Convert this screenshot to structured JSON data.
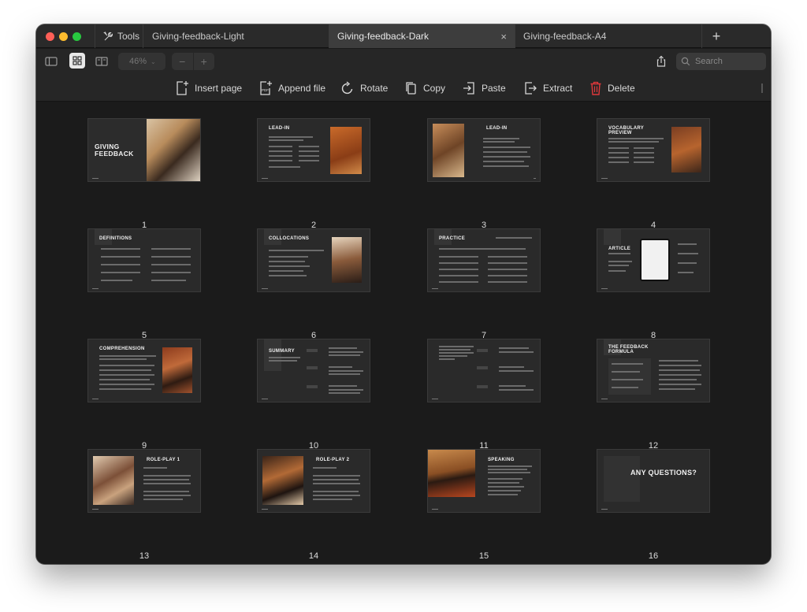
{
  "tabbar": {
    "tools_label": "Tools",
    "tabs": [
      {
        "label": "Giving-feedback-Light"
      },
      {
        "label": "Giving-feedback-Dark",
        "active": true
      },
      {
        "label": "Giving-feedback-A4"
      }
    ],
    "close_symbol": "×",
    "new_tab_symbol": "+"
  },
  "toolbar": {
    "zoom": "46%",
    "zoom_out": "−",
    "zoom_in": "+",
    "search_placeholder": "Search",
    "view_icons": [
      "sidebar-icon",
      "grid-view-icon",
      "page-view-icon"
    ]
  },
  "actions": [
    {
      "label": "Insert page",
      "icon": "insert-page-icon"
    },
    {
      "label": "Append file",
      "icon": "append-pdf-icon"
    },
    {
      "label": "Rotate",
      "icon": "rotate-icon"
    },
    {
      "label": "Copy",
      "icon": "copy-icon"
    },
    {
      "label": "Paste",
      "icon": "paste-icon"
    },
    {
      "label": "Extract",
      "icon": "extract-icon"
    },
    {
      "label": "Delete",
      "icon": "trash-icon",
      "color": "#e0383b"
    }
  ],
  "pages": [
    {
      "number": "1",
      "title": "GIVING FEEDBACK"
    },
    {
      "number": "2",
      "title": "LEAD-IN"
    },
    {
      "number": "3",
      "title": "LEAD-IN"
    },
    {
      "number": "4",
      "title": "VOCABULARY PREVIEW"
    },
    {
      "number": "5",
      "title": "DEFINITIONS"
    },
    {
      "number": "6",
      "title": "COLLOCATIONS"
    },
    {
      "number": "7",
      "title": "PRACTICE"
    },
    {
      "number": "8",
      "title": "ARTICLE"
    },
    {
      "number": "9",
      "title": "COMPREHENSION"
    },
    {
      "number": "10",
      "title": "SUMMARY"
    },
    {
      "number": "11",
      "title": ""
    },
    {
      "number": "12",
      "title": "THE FEEDBACK FORMULA"
    },
    {
      "number": "13",
      "title": "ROLE-PLAY 1"
    },
    {
      "number": "14",
      "title": "ROLE-PLAY 2"
    },
    {
      "number": "15",
      "title": "SPEAKING"
    },
    {
      "number": "16",
      "title": "ANY QUESTIONS?"
    }
  ],
  "colors": {
    "window_bg": "#1b1b1b",
    "toolbar_bg": "#262626",
    "active_tab": "#3d3d3d",
    "slide_bg": "#2a2a2a",
    "delete_red": "#e0383b"
  }
}
